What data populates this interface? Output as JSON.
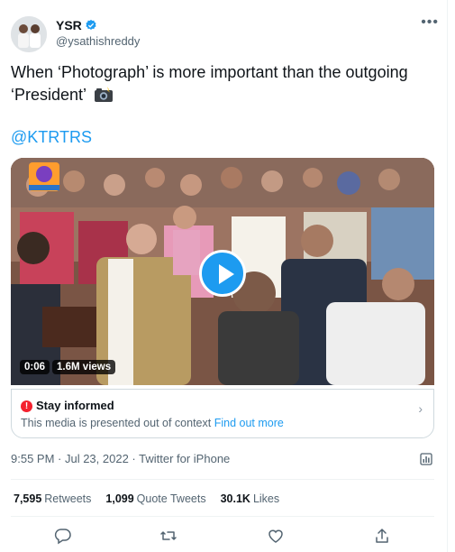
{
  "author": {
    "name": "YSR",
    "handle": "@ysathishreddy",
    "verified": true
  },
  "tweet": {
    "text": "When ‘Photograph’ is more important than the outgoing ‘President’",
    "emoji": "camera-with-flash",
    "mention": "@KTRTRS"
  },
  "media": {
    "type": "video",
    "duration": "0:06",
    "views": "1.6M views",
    "play_color": "#1d9bf0"
  },
  "context_notice": {
    "title": "Stay informed",
    "body": "This media is presented out of context",
    "link": "Find out more"
  },
  "meta": {
    "timestamp": "9:55 PM · Jul 23, 2022 · Twitter for iPhone"
  },
  "stats": [
    {
      "count": "7,595",
      "label": "Retweets"
    },
    {
      "count": "1,099",
      "label": "Quote Tweets"
    },
    {
      "count": "30.1K",
      "label": "Likes"
    }
  ],
  "colors": {
    "accent": "#1d9bf0",
    "muted": "#536471",
    "alert": "#f4212e"
  },
  "icons": {
    "more": "more-horizontal-icon",
    "reply": "reply-icon",
    "retweet": "retweet-icon",
    "like": "heart-icon",
    "share": "share-icon"
  }
}
